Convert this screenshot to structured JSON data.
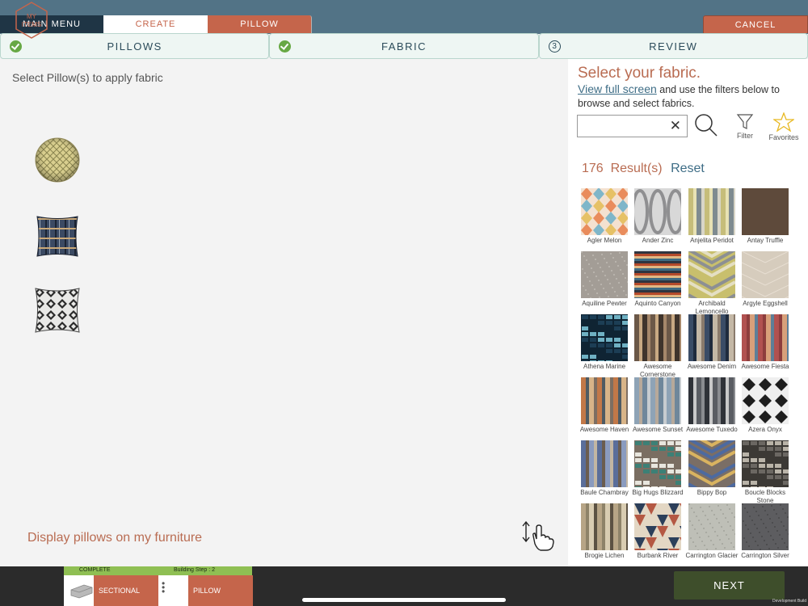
{
  "nav": {
    "main_menu": "MAIN MENU",
    "create": "CREATE",
    "pillow": "PILLOW",
    "cancel": "CANCEL"
  },
  "steps": [
    {
      "label": "PILLOWS",
      "status": "complete",
      "icon": "check-circle-icon"
    },
    {
      "label": "FABRIC",
      "status": "complete",
      "icon": "check-circle-icon"
    },
    {
      "label": "REVIEW",
      "status": "pending",
      "number": "3"
    }
  ],
  "left": {
    "instruction": "Select Pillow(s) to apply fabric",
    "display_link": "Display pillows on my furniture",
    "pillows": [
      {
        "name": "round-yellow-pillow"
      },
      {
        "name": "square-blue-plaid-pillow"
      },
      {
        "name": "square-black-white-pillow"
      }
    ]
  },
  "fabric_panel": {
    "title": "Select your fabric.",
    "view_full": "View full screen",
    "subtitle_rest": " and use the filters below to browse and select fabrics.",
    "search_value": "",
    "filter_label": "Filter",
    "favorites_label": "Favorites",
    "results_count": "176",
    "results_label": "Result(s)",
    "reset_label": "Reset"
  },
  "fabrics": [
    {
      "name": "Agler Melon",
      "pattern": "harlequin",
      "colors": [
        "#e98c5c",
        "#7fb6c9",
        "#e6c166",
        "#f4e1d0"
      ]
    },
    {
      "name": "Ander Zinc",
      "pattern": "trellis",
      "colors": [
        "#8f8f91",
        "#d8d8d8"
      ]
    },
    {
      "name": "Anjelita Peridot",
      "pattern": "vstripe",
      "colors": [
        "#c6bd7a",
        "#d9d6c8",
        "#7f8b90",
        "#e8e2b4"
      ]
    },
    {
      "name": "Antay Truffle",
      "pattern": "solid",
      "colors": [
        "#5e4a3b"
      ]
    },
    {
      "name": "Aquiline Pewter",
      "pattern": "texture",
      "colors": [
        "#b8b3ac",
        "#a39d96"
      ]
    },
    {
      "name": "Aquinto Canyon",
      "pattern": "hstripe",
      "colors": [
        "#2f3540",
        "#b44a2b",
        "#e0b884",
        "#3e6b83"
      ]
    },
    {
      "name": "Archibald Lemoncello",
      "pattern": "chevron",
      "colors": [
        "#8c8f93",
        "#e4dfc3",
        "#c8bf6d"
      ]
    },
    {
      "name": "Argyle Eggshell",
      "pattern": "diamond",
      "colors": [
        "#e8dfd3",
        "#d6ccbd"
      ]
    },
    {
      "name": "Athena Marine",
      "pattern": "blocks",
      "colors": [
        "#1c3e55",
        "#6fb1c3",
        "#0f2433"
      ]
    },
    {
      "name": "Awesome Cornerstone",
      "pattern": "vstripe",
      "colors": [
        "#6b5848",
        "#a5876a",
        "#3f342c",
        "#c8a983"
      ]
    },
    {
      "name": "Awesome Denim",
      "pattern": "vstripe",
      "colors": [
        "#3a4c66",
        "#8a7b6c",
        "#c4b8a6",
        "#1f2b3d"
      ]
    },
    {
      "name": "Awesome Fiesta",
      "pattern": "vstripe",
      "colors": [
        "#b15150",
        "#5d7f98",
        "#d8a07a",
        "#8d3d3d"
      ]
    },
    {
      "name": "Awesome Haven",
      "pattern": "vstripe",
      "colors": [
        "#c27848",
        "#7d6e62",
        "#d8b488",
        "#4f5b63"
      ]
    },
    {
      "name": "Awesome Sunset",
      "pattern": "vstripe",
      "colors": [
        "#8ea3b6",
        "#c7ccd0",
        "#6f879b",
        "#b7a99a"
      ]
    },
    {
      "name": "Awesome Tuxedo",
      "pattern": "vstripe",
      "colors": [
        "#2f3238",
        "#8a8c90",
        "#5a5d63",
        "#c9c9c9"
      ]
    },
    {
      "name": "Azera Onyx",
      "pattern": "kilim",
      "colors": [
        "#1e1e1e",
        "#efefef"
      ]
    },
    {
      "name": "Baule Chambray",
      "pattern": "vstripe",
      "colors": [
        "#5a6e9a",
        "#c2b6a3",
        "#8a9bbf",
        "#6b5d4f"
      ]
    },
    {
      "name": "Big Hugs Blizzard",
      "pattern": "blocks",
      "colors": [
        "#3c8076",
        "#e8e6de",
        "#7a6e62"
      ]
    },
    {
      "name": "Bippy Bop",
      "pattern": "chevron",
      "colors": [
        "#4d6aa0",
        "#d9b360",
        "#7a6e66"
      ]
    },
    {
      "name": "Boucle Blocks Stone",
      "pattern": "blocks",
      "colors": [
        "#6b6762",
        "#b9b3a8",
        "#3c3935"
      ]
    },
    {
      "name": "Brogie Lichen",
      "pattern": "vstripe",
      "colors": [
        "#b7a586",
        "#5c5243",
        "#d9cdb2",
        "#8e8369"
      ]
    },
    {
      "name": "Burbank River",
      "pattern": "triangles",
      "colors": [
        "#2c3f5a",
        "#b45843",
        "#e3d7c4"
      ]
    },
    {
      "name": "Carrington Glacier",
      "pattern": "texture",
      "colors": [
        "#a9aaa2",
        "#bebfb7"
      ]
    },
    {
      "name": "Carrington Silver",
      "pattern": "texture",
      "colors": [
        "#4d4d4f",
        "#5d5d60"
      ]
    }
  ],
  "bottom": {
    "my_items": [
      "MY",
      "ITEMS"
    ],
    "tracker_status": "COMPLETE",
    "tracker_step": "Building Step : 2",
    "sectional": "SECTIONAL",
    "pillow": "PILLOW",
    "next": "NEXT",
    "dev_build": "Development Build"
  }
}
